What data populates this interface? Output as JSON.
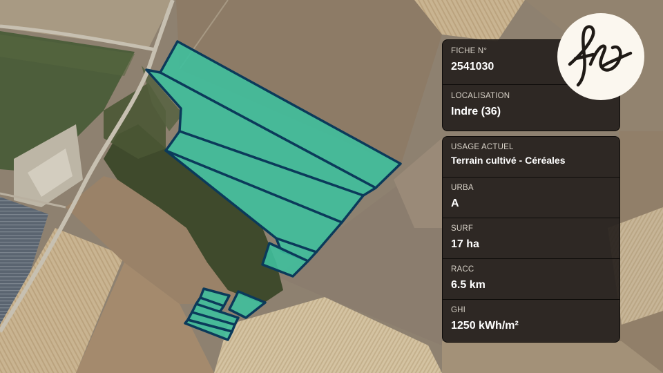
{
  "fiche": {
    "label": "FICHE N°",
    "value": "2541030"
  },
  "localisation": {
    "label": "LOCALISATION",
    "value": "Indre (36)"
  },
  "usage": {
    "label": "USAGE ACTUEL",
    "value": "Terrain cultivé - Céréales"
  },
  "urba": {
    "label": "URBA",
    "value": "A"
  },
  "surf": {
    "label": "SURF",
    "value": "17 ha"
  },
  "racc": {
    "label": "RACC",
    "value": "6.5 km"
  },
  "ghi": {
    "label": "GHI",
    "value": "1250 kWh/m²"
  },
  "logo": {
    "text": "fs"
  },
  "colors": {
    "parcel_fill": "#3fbf9c",
    "parcel_stroke": "#0b3a5a",
    "card_bg": "#26211d",
    "logo_bg": "#fbf7ef"
  }
}
